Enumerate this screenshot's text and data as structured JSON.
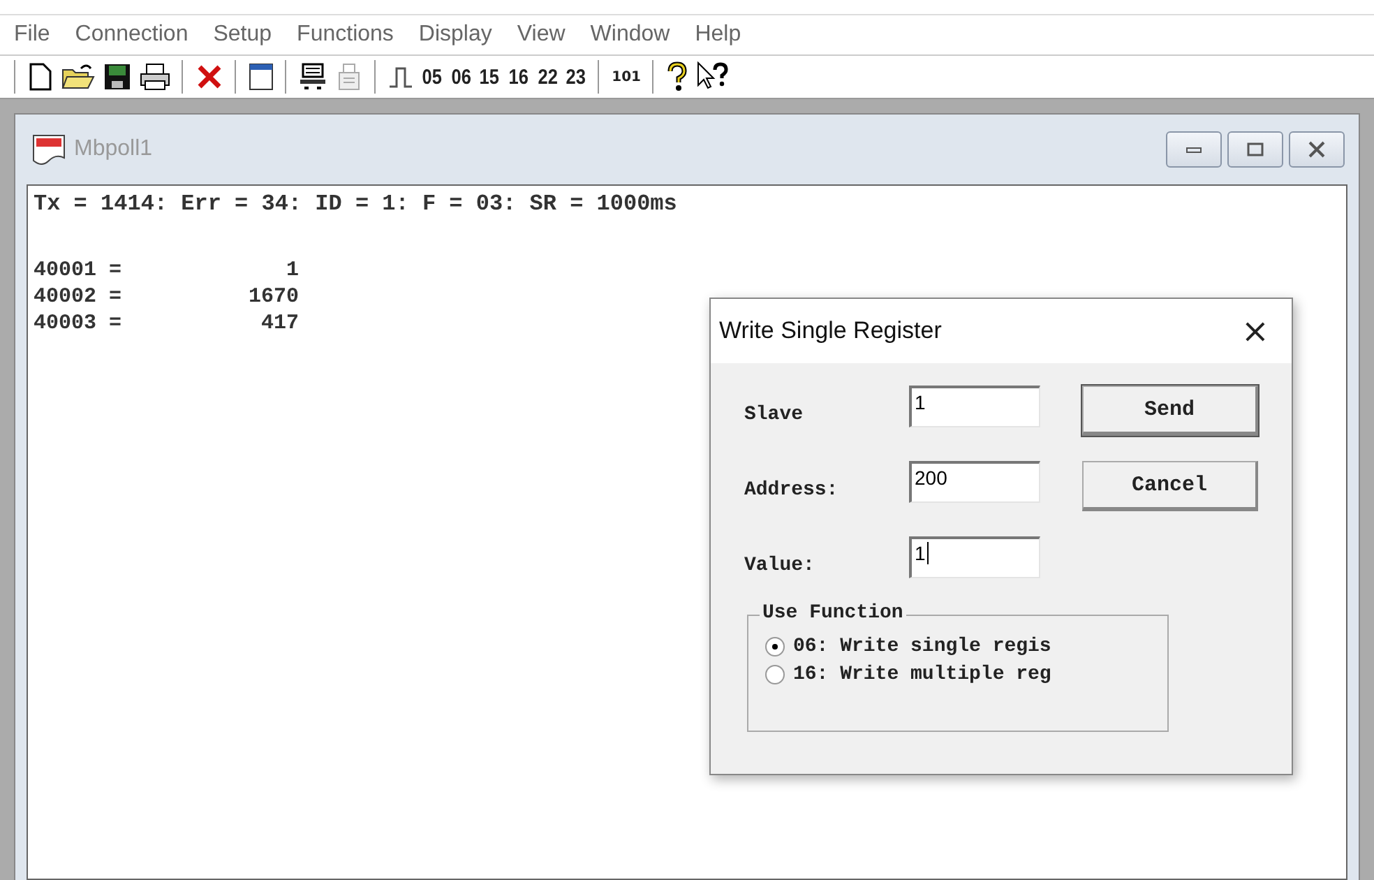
{
  "menu": [
    "File",
    "Connection",
    "Setup",
    "Functions",
    "Display",
    "View",
    "Window",
    "Help"
  ],
  "toolbar": {
    "function_codes": [
      "05",
      "06",
      "15",
      "16",
      "22",
      "23"
    ],
    "address_button": "101"
  },
  "child_window": {
    "title": "Mbpoll1",
    "status_line": "Tx = 1414: Err = 34: ID = 1: F = 03: SR = 1000ms",
    "registers": [
      {
        "address": "40001 =",
        "value": "1"
      },
      {
        "address": "40002 =",
        "value": "1670"
      },
      {
        "address": "40003 =",
        "value": "417"
      }
    ]
  },
  "dialog": {
    "title": "Write Single Register",
    "close": "×",
    "fields": [
      {
        "label": "Slave",
        "value": "1",
        "focused": false
      },
      {
        "label": "Address:",
        "value": "200",
        "focused": false
      },
      {
        "label": "Value:",
        "value": "1",
        "focused": true
      }
    ],
    "buttons": [
      {
        "label": "Send",
        "default": true
      },
      {
        "label": "Cancel",
        "default": false
      }
    ],
    "group": {
      "title": "Use Function",
      "options": [
        {
          "label": "06: Write single regis",
          "selected": true
        },
        {
          "label": "16: Write multiple reg",
          "selected": false
        }
      ]
    }
  }
}
